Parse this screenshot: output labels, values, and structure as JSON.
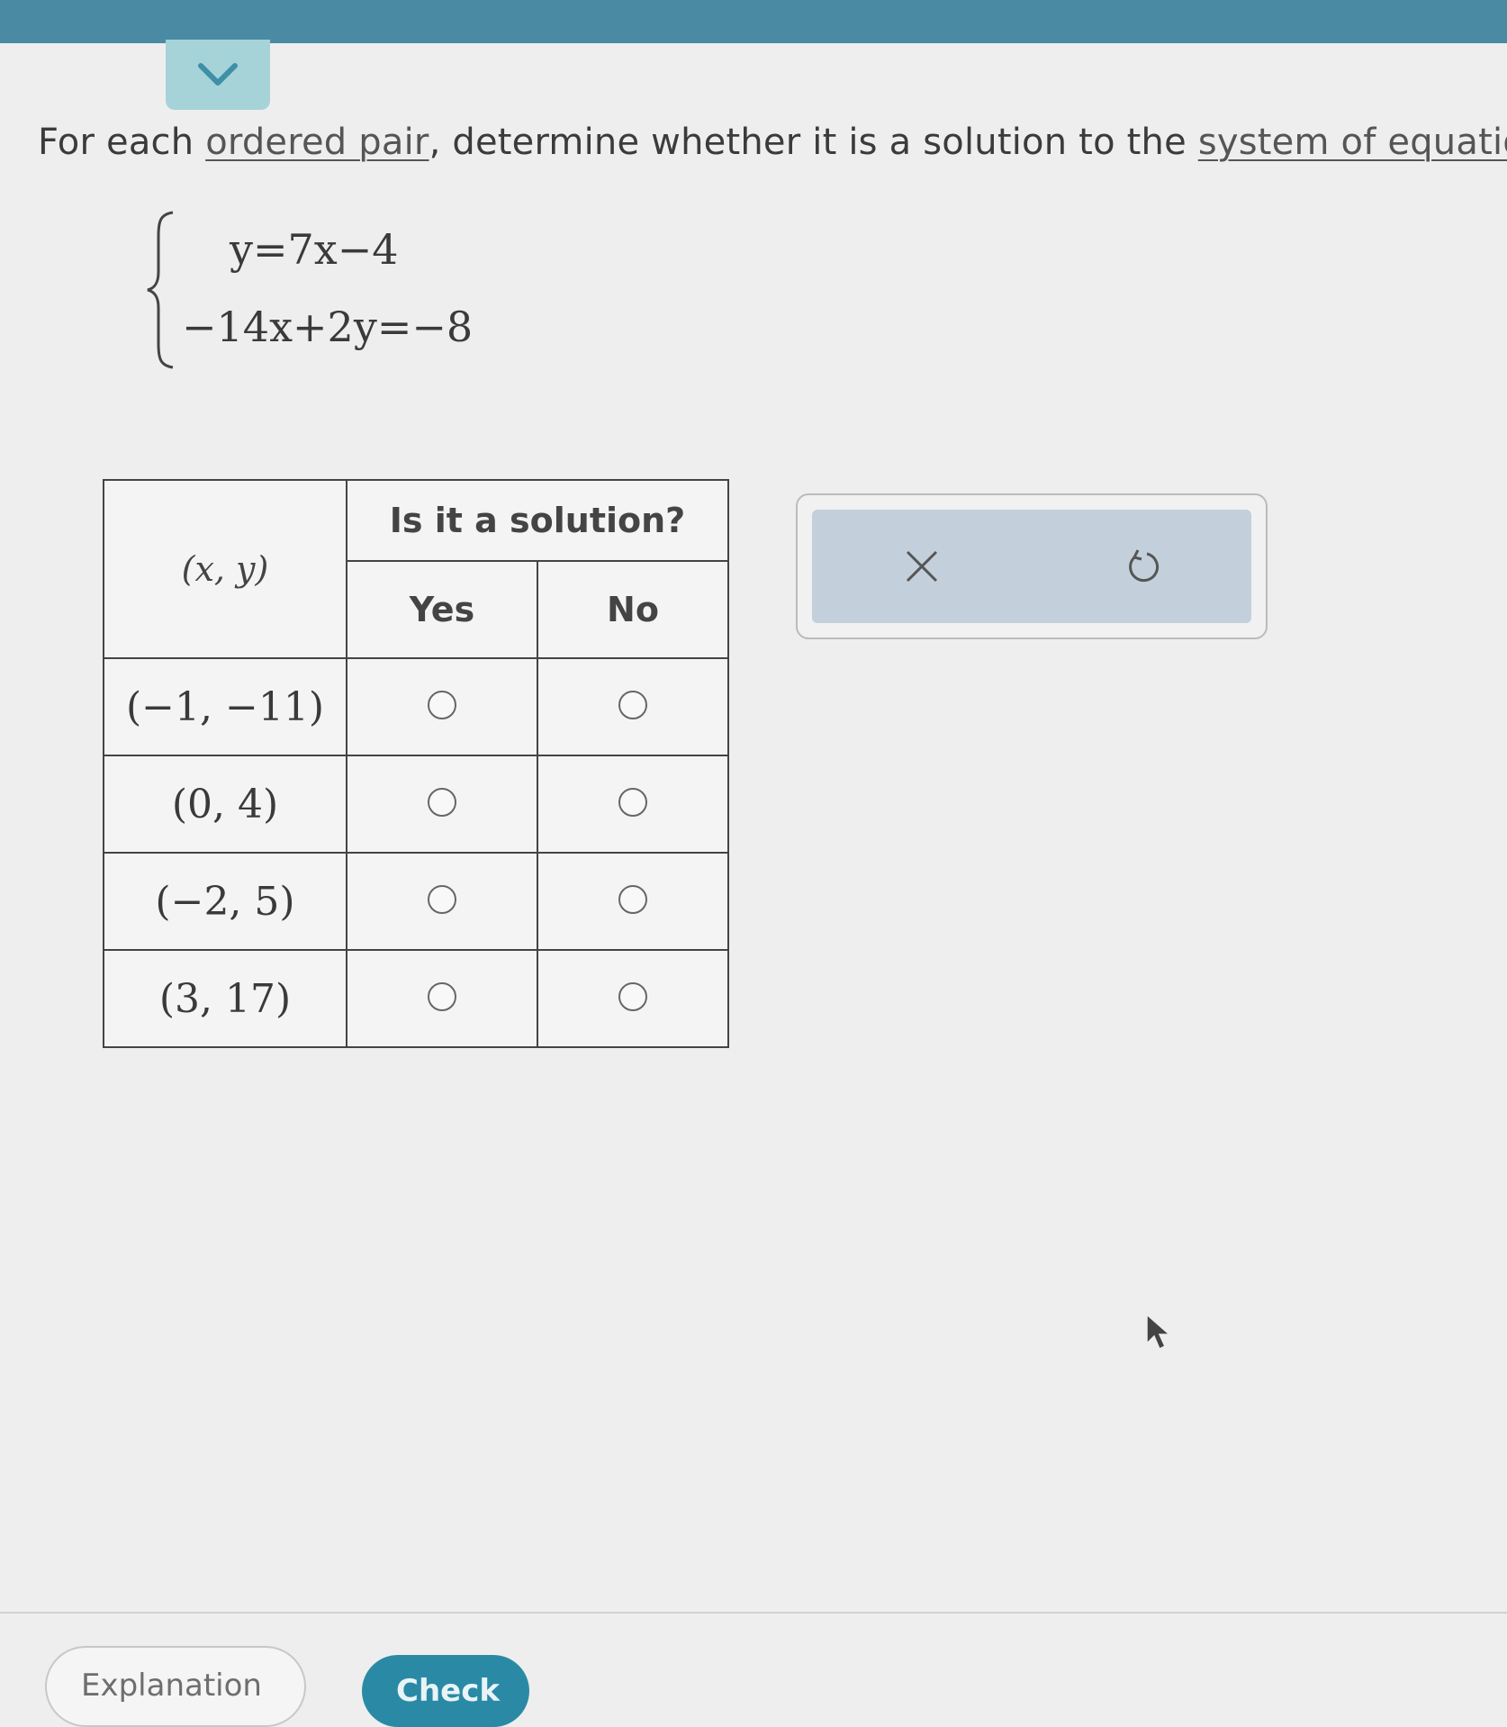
{
  "prompt": {
    "part1": "For each ",
    "link1": "ordered pair",
    "part2": ", determine whether it is a solution to the ",
    "link2": "system of equatio"
  },
  "system": {
    "eq1": "y=7x−4",
    "eq2": "−14x+2y=−8"
  },
  "table": {
    "pair_header": "(x, y)",
    "group_header": "Is it a solution?",
    "yes_header": "Yes",
    "no_header": "No",
    "rows": [
      {
        "pair": "(−1, −11)",
        "yes_selected": false,
        "no_selected": false
      },
      {
        "pair": "(0, 4)",
        "yes_selected": false,
        "no_selected": false
      },
      {
        "pair": "(−2, 5)",
        "yes_selected": false,
        "no_selected": false
      },
      {
        "pair": "(3, 17)",
        "yes_selected": false,
        "no_selected": false
      }
    ]
  },
  "tools": {
    "clear_icon": "x-icon",
    "reset_icon": "undo-icon"
  },
  "footer": {
    "explanation_label": "Explanation",
    "check_label": "Check"
  },
  "colors": {
    "topbar": "#4a8aa3",
    "collapse_tab": "#a6d3d8",
    "tools_panel": "#c3d0db",
    "check_button": "#2a8aa6"
  }
}
